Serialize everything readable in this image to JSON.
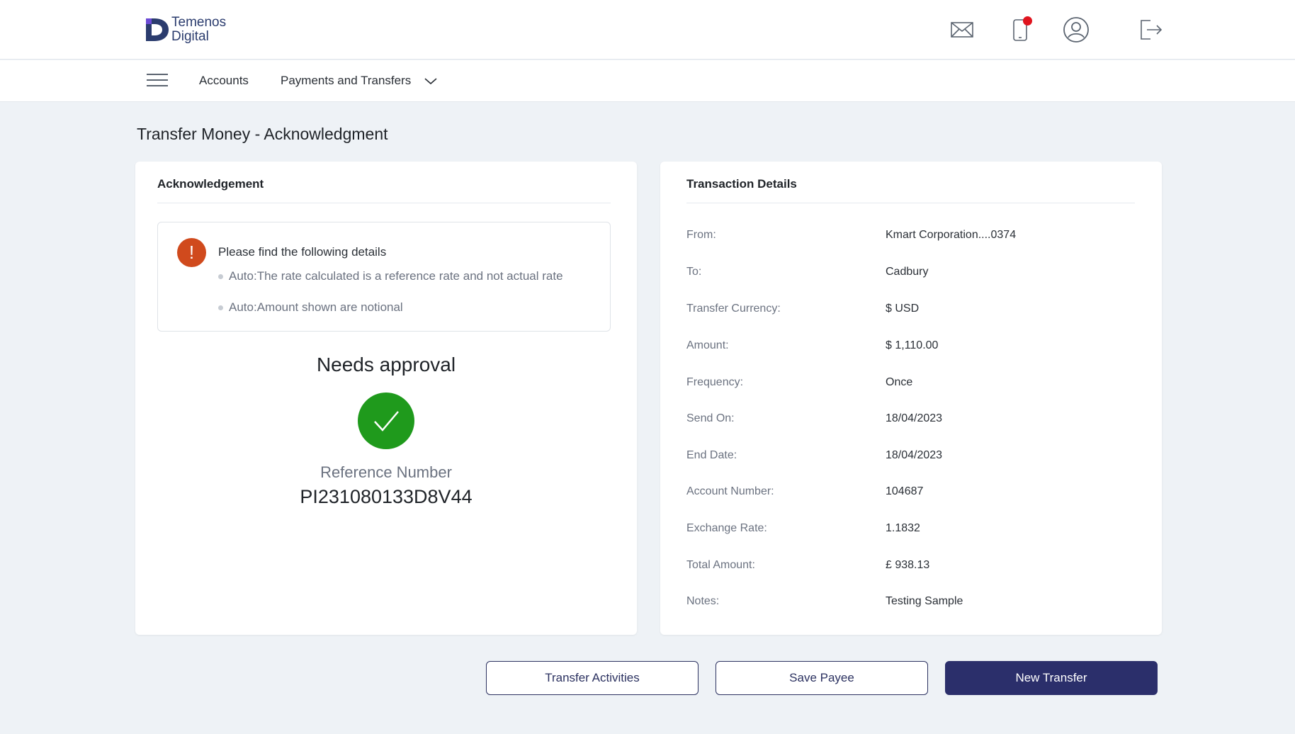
{
  "brand": {
    "line1": "Temenos",
    "line2": "Digital"
  },
  "header": {
    "icons": [
      "mail-icon",
      "mobile-notification-icon",
      "profile-icon",
      "logout-icon"
    ],
    "notification_color": "#e0141e"
  },
  "nav": {
    "items": [
      {
        "label": "Accounts"
      },
      {
        "label": "Payments and Transfers"
      }
    ]
  },
  "page": {
    "title": "Transfer Money - Acknowledgment"
  },
  "acknowledgement": {
    "title": "Acknowledgement",
    "info_heading": "Please find the following details",
    "bullets": [
      "Auto:The rate calculated is a reference rate and not actual rate",
      "Auto:Amount shown are notional"
    ],
    "status": "Needs approval",
    "reference_label": "Reference Number",
    "reference_value": "PI231080133D8V44",
    "success_color": "#1f9a1c",
    "warning_color": "#d04a1d"
  },
  "transaction": {
    "title": "Transaction Details",
    "rows": [
      {
        "label": "From:",
        "value": "Kmart Corporation....0374"
      },
      {
        "label": "To:",
        "value": "Cadbury"
      },
      {
        "label": "Transfer Currency:",
        "value": "$ USD"
      },
      {
        "label": "Amount:",
        "value": "$ 1,110.00"
      },
      {
        "label": "Frequency:",
        "value": "Once"
      },
      {
        "label": "Send On:",
        "value": "18/04/2023"
      },
      {
        "label": "End Date:",
        "value": "18/04/2023"
      },
      {
        "label": "Account Number:",
        "value": "104687"
      },
      {
        "label": "Exchange Rate:",
        "value": "1.1832"
      },
      {
        "label": "Total Amount:",
        "value": "£ 938.13"
      },
      {
        "label": "Notes:",
        "value": "Testing Sample"
      }
    ]
  },
  "actions": {
    "transfer_activities": "Transfer Activities",
    "save_payee": "Save Payee",
    "new_transfer": "New Transfer",
    "primary_color": "#2b2f6b"
  }
}
